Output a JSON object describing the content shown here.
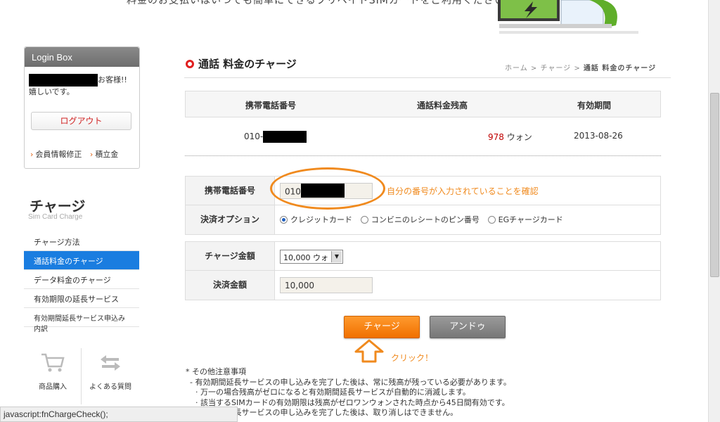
{
  "banner": {
    "text": "料金のお支払いはいつでも簡単にできるプリペイドSIMカードをご利用ください"
  },
  "login_box": {
    "title": "Login Box",
    "user_suffix": "お客様!!",
    "greeting": "嬉しいです。",
    "logout_label": "ログアウト",
    "links": [
      "会員情報修正",
      "積立金"
    ]
  },
  "sidebar": {
    "title": "チャージ",
    "subtitle": "Sim Card Charge",
    "items": [
      {
        "label": "チャージ方法",
        "active": false
      },
      {
        "label": "通話料金のチャージ",
        "active": true
      },
      {
        "label": "データ料金のチャージ",
        "active": false
      },
      {
        "label": "有効期限の延長サービス",
        "active": false
      },
      {
        "label": "有効期間延長サービス申込み内訳",
        "active": false
      }
    ],
    "quick_links": [
      {
        "label": "商品購入",
        "icon": "cart-icon"
      },
      {
        "label": "よくある質問",
        "icon": "faq-icon"
      }
    ]
  },
  "status_bar": {
    "text": "javascript:fnChargeCheck();"
  },
  "main": {
    "title": "通話 料金のチャージ",
    "breadcrumb": [
      "ホーム",
      "チャージ",
      "通話 料金のチャージ"
    ],
    "info_table": {
      "headers": [
        "携帯電話番号",
        "通話料金残高",
        "有効期間"
      ],
      "phone_prefix": "010-",
      "balance_value": "978",
      "balance_unit": "ウォン",
      "expiry": "2013-08-26"
    },
    "form": {
      "phone_label": "携帯電話番号",
      "phone_value": "010",
      "phone_note": "自分の番号が入力されていることを確認",
      "payment_label": "決済オプション",
      "payment_options": [
        {
          "label": "クレジットカード",
          "selected": true
        },
        {
          "label": "コンビニのレシートのピン番号",
          "selected": false
        },
        {
          "label": "EGチャージカード",
          "selected": false
        }
      ],
      "amount_label": "チャージ金額",
      "amount_value": "10,000 ウォ",
      "settle_label": "決済金額",
      "settle_value": "10,000"
    },
    "buttons": {
      "charge": "チャージ",
      "undo": "アンドゥ",
      "click_note": "クリック！"
    },
    "notes": {
      "heading": "* その他注意事項",
      "lines": [
        "- 有効期間延長サービスの申し込みを完了した後は、常に残高が残っている必要があります。",
        "· 万一の場合残高がゼロになると有効期間延長サービスが自動的に消滅します。",
        "· 該当するSIMカードの有効期限は残高がゼロワンウォンされた時点から45日間有効です。",
        "- 有効期間延長サービスの申し込みを完了した後は、取り消しはできません。"
      ]
    }
  }
}
